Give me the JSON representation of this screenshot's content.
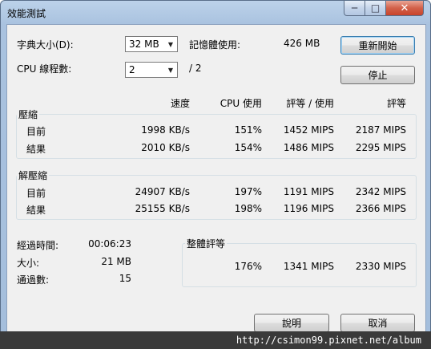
{
  "window": {
    "title": "效能測試",
    "min_glyph": "─",
    "max_glyph": "□",
    "close_glyph": "✕"
  },
  "settings": {
    "dict_label": "字典大小(D):",
    "dict_value": "32 MB",
    "mem_label": "記憶體使用:",
    "mem_value": "426 MB",
    "cpu_label": "CPU 線程數:",
    "cpu_value": "2",
    "cpu_total": "/ 2"
  },
  "buttons": {
    "restart": "重新開始",
    "stop": "停止",
    "help": "說明",
    "cancel": "取消"
  },
  "columns": {
    "speed": "速度",
    "cpu_usage": "CPU 使用",
    "rating_usage": "評等 / 使用",
    "rating": "評等"
  },
  "compress": {
    "label": "壓縮",
    "current": {
      "label": "目前",
      "speed": "1998 KB/s",
      "cpu": "151%",
      "rating_usage": "1452 MIPS",
      "rating": "2187 MIPS"
    },
    "result": {
      "label": "結果",
      "speed": "2010 KB/s",
      "cpu": "154%",
      "rating_usage": "1486 MIPS",
      "rating": "2295 MIPS"
    }
  },
  "decompress": {
    "label": "解壓縮",
    "current": {
      "label": "目前",
      "speed": "24907 KB/s",
      "cpu": "197%",
      "rating_usage": "1191 MIPS",
      "rating": "2342 MIPS"
    },
    "result": {
      "label": "結果",
      "speed": "25155 KB/s",
      "cpu": "198%",
      "rating_usage": "1196 MIPS",
      "rating": "2366 MIPS"
    }
  },
  "stats": {
    "elapsed_label": "經過時間:",
    "elapsed_value": "00:06:23",
    "size_label": "大小:",
    "size_value": "21 MB",
    "passes_label": "通過數:",
    "passes_value": "15"
  },
  "overall": {
    "label": "整體評等",
    "cpu": "176%",
    "rating_usage": "1341 MIPS",
    "rating": "2330 MIPS"
  },
  "watermark": "http://csimon99.pixnet.net/album"
}
